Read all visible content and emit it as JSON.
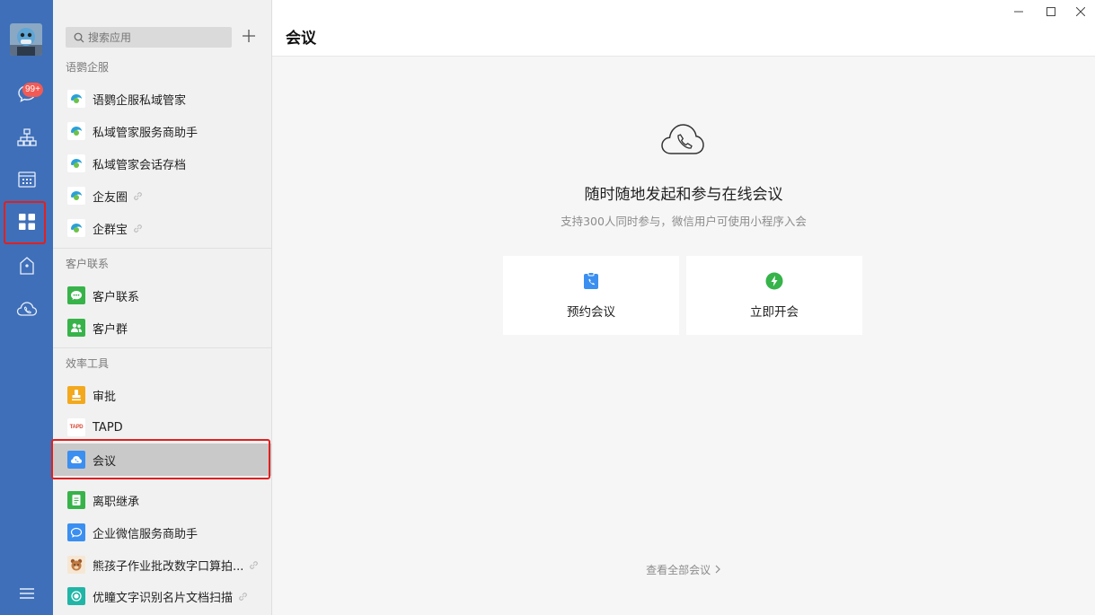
{
  "nav": {
    "messages_badge": "99+"
  },
  "panel": {
    "search": {
      "placeholder": "搜索应用"
    },
    "sections": [
      {
        "title": "语鹦企服",
        "items": [
          {
            "label": "语鹦企服私域管家"
          },
          {
            "label": "私域管家服务商助手"
          },
          {
            "label": "私域管家会话存档"
          },
          {
            "label": "企友圈"
          },
          {
            "label": "企群宝"
          }
        ]
      },
      {
        "title": "客户联系",
        "items": [
          {
            "label": "客户联系"
          },
          {
            "label": "客户群"
          }
        ]
      },
      {
        "title": "效率工具",
        "items": [
          {
            "label": "审批"
          },
          {
            "label": "TAPD"
          },
          {
            "label": "会议"
          },
          {
            "label": "离职继承"
          },
          {
            "label": "企业微信服务商助手"
          },
          {
            "label": "熊孩子作业批改数字口算拍..."
          },
          {
            "label": "优瞳文字识别名片文档扫描"
          }
        ]
      }
    ],
    "tapd_logo_text": "TAPD"
  },
  "main": {
    "title": "会议",
    "hero_title": "随时随地发起和参与在线会议",
    "hero_subtitle": "支持300人同时参与，微信用户可使用小程序入会",
    "actions": [
      {
        "label": "预约会议"
      },
      {
        "label": "立即开会"
      }
    ],
    "view_all": "查看全部会议"
  },
  "colors": {
    "rail": "#3f6fb8",
    "badge": "#f25a55",
    "highlight": "#e02020",
    "schedule_icon": "#3b8ff0",
    "start_icon": "#36b34a"
  }
}
